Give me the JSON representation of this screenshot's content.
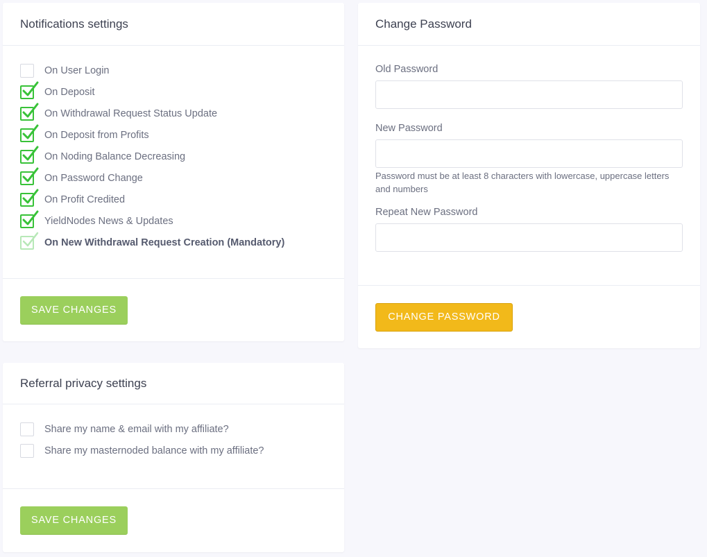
{
  "notifications": {
    "title": "Notifications settings",
    "items": [
      {
        "label": "On User Login",
        "checked": false
      },
      {
        "label": "On Deposit",
        "checked": true
      },
      {
        "label": "On Withdrawal Request Status Update",
        "checked": true
      },
      {
        "label": "On Deposit from Profits",
        "checked": true
      },
      {
        "label": "On Noding Balance Decreasing",
        "checked": true
      },
      {
        "label": "On Password Change",
        "checked": true
      },
      {
        "label": "On Profit Credited",
        "checked": true
      },
      {
        "label": "YieldNodes News & Updates",
        "checked": true
      },
      {
        "label": "On New Withdrawal Request Creation (Mandatory)",
        "checked": true,
        "disabled": true
      }
    ],
    "save_label": "SAVE CHANGES"
  },
  "password": {
    "title": "Change Password",
    "old_label": "Old Password",
    "new_label": "New Password",
    "hint": "Password must be at least 8 characters with lowercase, uppercase letters and numbers",
    "repeat_label": "Repeat New Password",
    "button_label": "CHANGE PASSWORD"
  },
  "referral": {
    "title": "Referral privacy settings",
    "items": [
      {
        "label": "Share my name & email with my affiliate?",
        "checked": false
      },
      {
        "label": "Share my masternoded balance with my affiliate?",
        "checked": false
      }
    ],
    "save_label": "SAVE CHANGES"
  },
  "colors": {
    "page_bg": "#f7f7fc",
    "check_green": "#38c238",
    "save_green": "#9bcf5c",
    "password_yellow": "#f2b91a"
  },
  "icons": {
    "checked": "check-icon"
  }
}
